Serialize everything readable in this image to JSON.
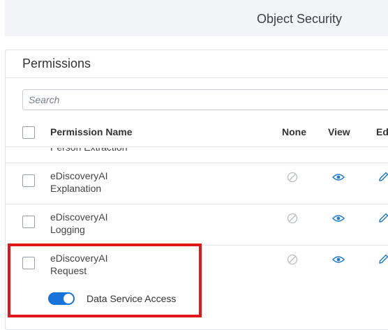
{
  "header": {
    "title": "Object Security"
  },
  "permissions": {
    "title": "Permissions",
    "search_placeholder": "Search",
    "columns": {
      "name": "Permission Name",
      "none": "None",
      "view": "View",
      "edit": "Edi"
    },
    "partial_row": {
      "name": "Person Extraction"
    },
    "rows": [
      {
        "line1": "eDiscoveryAI",
        "line2": "Explanation"
      },
      {
        "line1": "eDiscoveryAI",
        "line2": "Logging"
      },
      {
        "line1": "eDiscoveryAI",
        "line2": "Request"
      }
    ],
    "data_service_access": {
      "label": "Data Service Access",
      "enabled": true
    }
  },
  "colors": {
    "accent": "#1673d9",
    "highlight": "#e0161b",
    "icon_disabled": "#b8bdc4",
    "icon_active": "#1f7ccf"
  },
  "icons": [
    "none-icon",
    "view-icon",
    "edit-icon"
  ]
}
